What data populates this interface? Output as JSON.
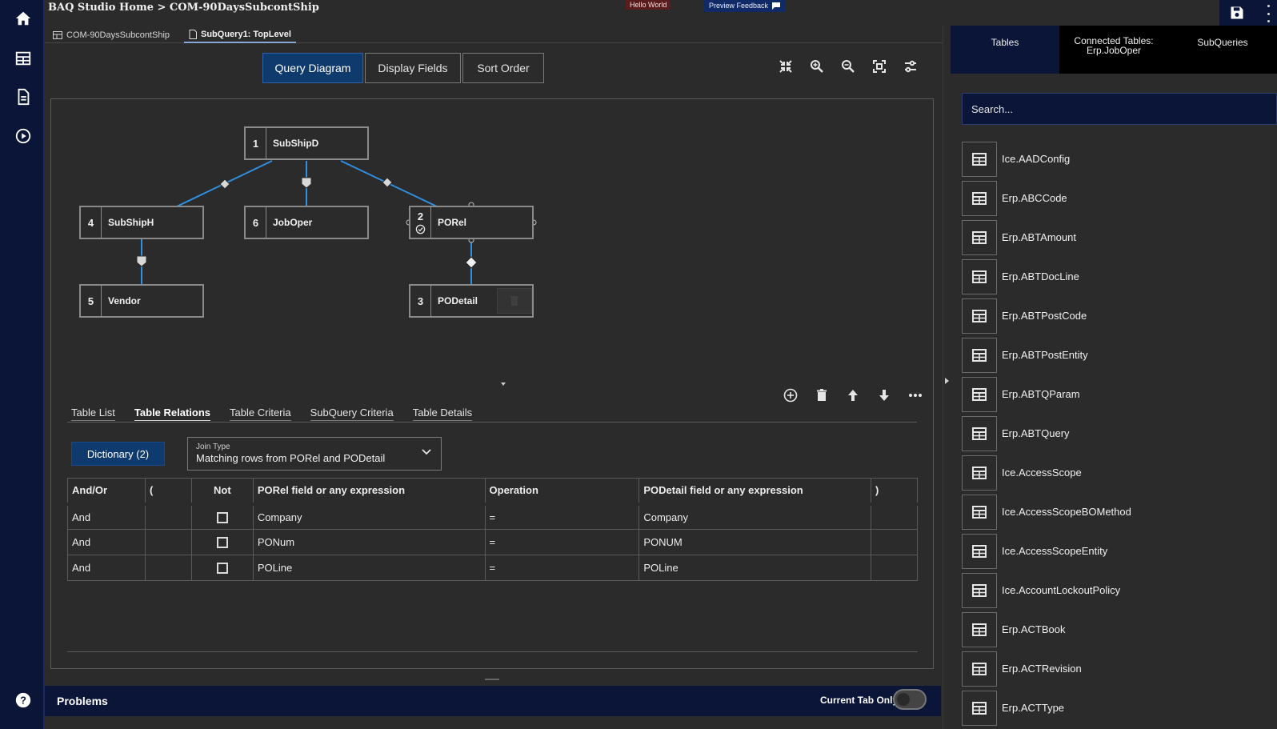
{
  "header": {
    "breadcrumb": "BAQ Studio Home  >  COM-90DaysSubcontShip",
    "hello_badge": "Hello World",
    "preview_feedback": "Preview Feedback"
  },
  "doc_tabs": [
    {
      "label": "COM-90DaysSubcontShip"
    },
    {
      "label": "SubQuery1: TopLevel"
    }
  ],
  "view_tabs": [
    {
      "label": "Query Diagram"
    },
    {
      "label": "Display Fields"
    },
    {
      "label": "Sort Order"
    }
  ],
  "diagram": {
    "nodes": [
      {
        "num": "1",
        "label": "SubShipD"
      },
      {
        "num": "4",
        "label": "SubShipH"
      },
      {
        "num": "6",
        "label": "JobOper"
      },
      {
        "num": "2",
        "label": "PORel"
      },
      {
        "num": "5",
        "label": "Vendor"
      },
      {
        "num": "3",
        "label": "PODetail"
      }
    ]
  },
  "sub_tabs": [
    {
      "label": "Table List"
    },
    {
      "label": "Table Relations"
    },
    {
      "label": "Table Criteria"
    },
    {
      "label": "SubQuery Criteria"
    },
    {
      "label": "Table Details"
    }
  ],
  "relations": {
    "dictionary_button": "Dictionary (2)",
    "join_type_label": "Join Type",
    "join_type_value": "Matching rows from PORel and PODetail",
    "columns": [
      "And/Or",
      "(",
      "Not",
      "PORel field or any expression",
      "Operation",
      "PODetail field or any expression",
      ")"
    ],
    "rows": [
      {
        "andor": "And",
        "open": "",
        "not": false,
        "left": "Company",
        "op": "=",
        "right": "Company",
        "close": ""
      },
      {
        "andor": "And",
        "open": "",
        "not": false,
        "left": "PONum",
        "op": "=",
        "right": "PONUM",
        "close": ""
      },
      {
        "andor": "And",
        "open": "",
        "not": false,
        "left": "POLine",
        "op": "=",
        "right": "POLine",
        "close": ""
      }
    ]
  },
  "problems": {
    "title": "Problems",
    "current_tab_only": "Current Tab Only"
  },
  "right_panel": {
    "tabs": [
      {
        "label": "Tables",
        "sub": ""
      },
      {
        "label": "Connected Tables:",
        "sub": "Erp.JobOper"
      },
      {
        "label": "SubQueries",
        "sub": ""
      }
    ],
    "search_placeholder": "Search...",
    "tables": [
      "Ice.AADConfig",
      "Erp.ABCCode",
      "Erp.ABTAmount",
      "Erp.ABTDocLine",
      "Erp.ABTPostCode",
      "Erp.ABTPostEntity",
      "Erp.ABTQParam",
      "Erp.ABTQuery",
      "Ice.AccessScope",
      "Ice.AccessScopeBOMethod",
      "Ice.AccessScopeEntity",
      "Ice.AccountLockoutPolicy",
      "Erp.ACTBook",
      "Erp.ACTRevision",
      "Erp.ACTType"
    ]
  },
  "colors": {
    "nav_bg": "#0b1538",
    "accent": "#0f3a6e",
    "link_line": "#2f8fe0"
  }
}
